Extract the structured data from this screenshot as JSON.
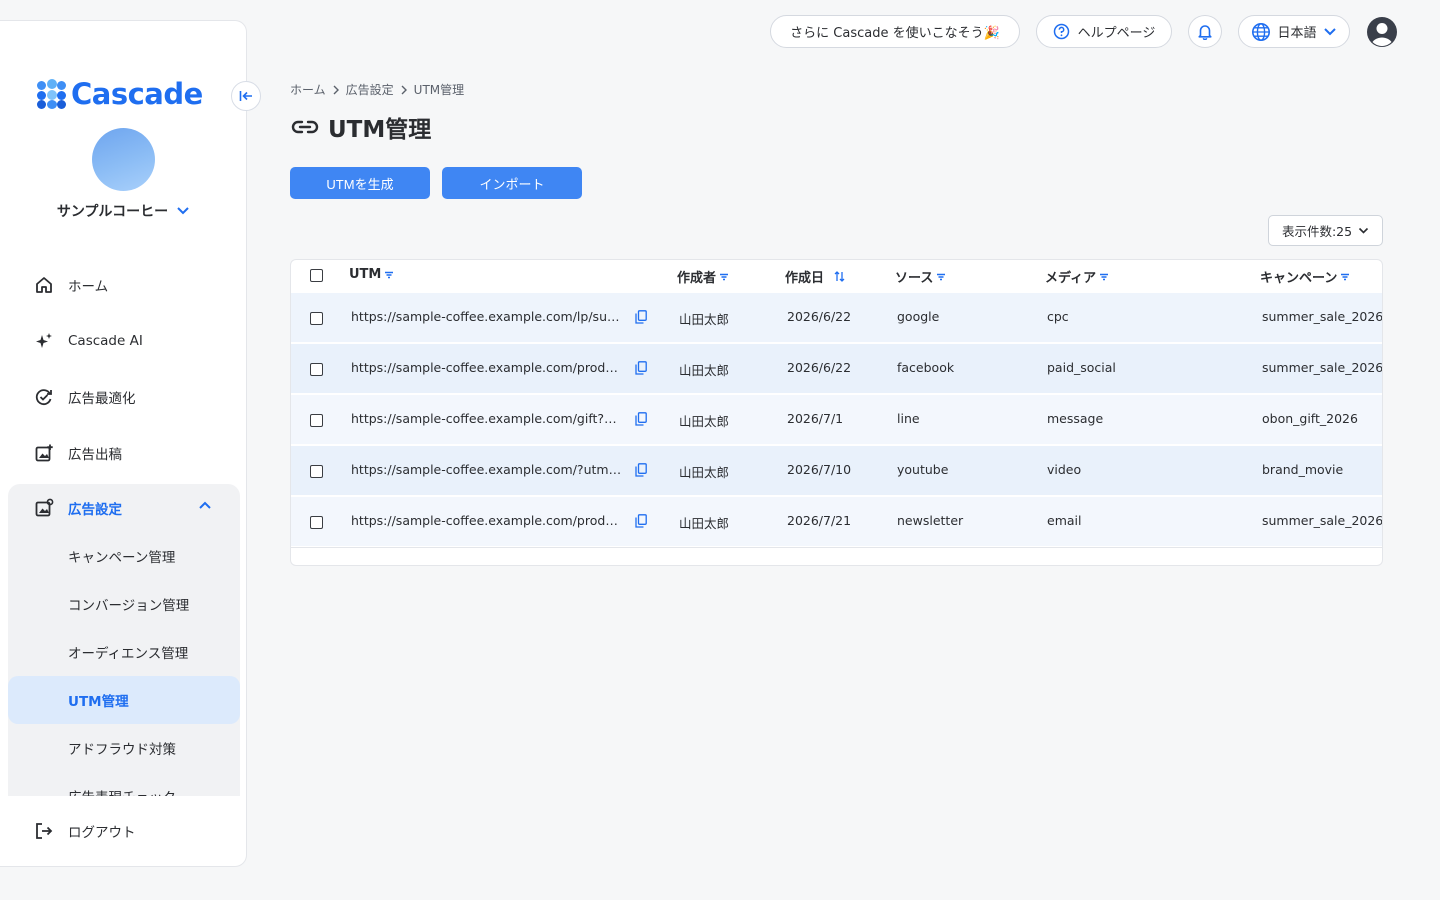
{
  "app": {
    "logo_text": "Cascade",
    "brand_color": "#1f6ef0"
  },
  "sidebar": {
    "company": "サンプルコーヒー",
    "nav": [
      {
        "label": "ホーム",
        "icon": "home-icon"
      },
      {
        "label": "Cascade AI",
        "icon": "sparkle-icon"
      },
      {
        "label": "広告最適化",
        "icon": "optimize-icon"
      },
      {
        "label": "広告出稿",
        "icon": "ad-publish-icon"
      }
    ],
    "group": {
      "label": "広告設定",
      "icon": "ad-settings-icon",
      "items": [
        {
          "label": "キャンペーン管理",
          "active": false
        },
        {
          "label": "コンバージョン管理",
          "active": false
        },
        {
          "label": "オーディエンス管理",
          "active": false
        },
        {
          "label": "UTM管理",
          "active": true
        },
        {
          "label": "アドフラウド対策",
          "active": false
        },
        {
          "label": "広告表現チェック",
          "active": false
        }
      ]
    },
    "logout": "ログアウト"
  },
  "topbar": {
    "promo": "さらに Cascade を使いこなそう🎉",
    "help": "ヘルプページ",
    "language": "日本語"
  },
  "breadcrumb": [
    "ホーム",
    "広告設定",
    "UTM管理"
  ],
  "page": {
    "title": "UTM管理",
    "generate_button": "UTMを生成",
    "import_button": "インポート",
    "per_page": "表示件数:25"
  },
  "table": {
    "columns": [
      "UTM",
      "作成者",
      "作成日",
      "ソース",
      "メディア",
      "キャンペーン"
    ],
    "rows": [
      {
        "utm": "https://sample-coffee.example.com/lp/summer?utm_source=google",
        "author": "山田太郎",
        "date": "2026/6/22",
        "source": "google",
        "medium": "cpc",
        "campaign": "summer_sale_2026"
      },
      {
        "utm": "https://sample-coffee.example.com/products?utm_source=facebook",
        "author": "山田太郎",
        "date": "2026/6/22",
        "source": "facebook",
        "medium": "paid_social",
        "campaign": "summer_sale_2026"
      },
      {
        "utm": "https://sample-coffee.example.com/gift?utm_source=line",
        "author": "山田太郎",
        "date": "2026/7/1",
        "source": "line",
        "medium": "message",
        "campaign": "obon_gift_2026"
      },
      {
        "utm": "https://sample-coffee.example.com/?utm_source=youtube",
        "author": "山田太郎",
        "date": "2026/7/10",
        "source": "youtube",
        "medium": "video",
        "campaign": "brand_movie"
      },
      {
        "utm": "https://sample-coffee.example.com/products?utm_source=newsletter",
        "author": "山田太郎",
        "date": "2026/7/21",
        "source": "newsletter",
        "medium": "email",
        "campaign": "summer_sale_2026"
      }
    ]
  }
}
